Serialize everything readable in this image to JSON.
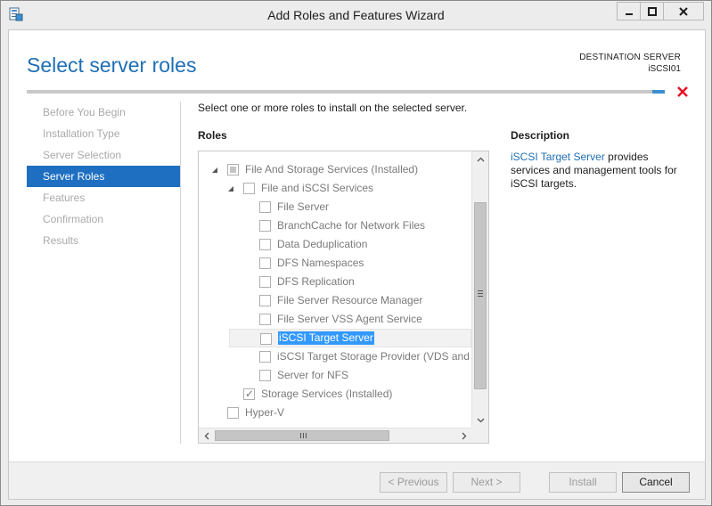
{
  "window": {
    "title": "Add Roles and Features Wizard",
    "minimize_label": "Minimize",
    "maximize_label": "Maximize",
    "close_label": "Close"
  },
  "header": {
    "page_title": "Select server roles",
    "destination_label": "DESTINATION SERVER",
    "destination_server": "iSCSI01"
  },
  "nav": {
    "items": [
      {
        "label": "Before You Begin",
        "active": false
      },
      {
        "label": "Installation Type",
        "active": false
      },
      {
        "label": "Server Selection",
        "active": false
      },
      {
        "label": "Server Roles",
        "active": true
      },
      {
        "label": "Features",
        "active": false
      },
      {
        "label": "Confirmation",
        "active": false
      },
      {
        "label": "Results",
        "active": false
      }
    ]
  },
  "main": {
    "instruction": "Select one or more roles to install on the selected server.",
    "roles_header": "Roles",
    "description_header": "Description",
    "description_link": "iSCSI Target Server",
    "description_text": " provides services and management tools for iSCSI targets."
  },
  "roles": [
    {
      "label": "File And Storage Services (Installed)",
      "level": 0,
      "expander": "expanded",
      "state": "partial"
    },
    {
      "label": "File and iSCSI Services",
      "level": 1,
      "expander": "expanded",
      "state": "unchecked"
    },
    {
      "label": "File Server",
      "level": 2,
      "expander": "",
      "state": "unchecked"
    },
    {
      "label": "BranchCache for Network Files",
      "level": 2,
      "expander": "",
      "state": "unchecked"
    },
    {
      "label": "Data Deduplication",
      "level": 2,
      "expander": "",
      "state": "unchecked"
    },
    {
      "label": "DFS Namespaces",
      "level": 2,
      "expander": "",
      "state": "unchecked"
    },
    {
      "label": "DFS Replication",
      "level": 2,
      "expander": "",
      "state": "unchecked"
    },
    {
      "label": "File Server Resource Manager",
      "level": 2,
      "expander": "",
      "state": "unchecked"
    },
    {
      "label": "File Server VSS Agent Service",
      "level": 2,
      "expander": "",
      "state": "unchecked"
    },
    {
      "label": "iSCSI Target Server",
      "level": 2,
      "expander": "",
      "state": "unchecked",
      "selected": true
    },
    {
      "label": "iSCSI Target Storage Provider (VDS and VSS",
      "level": 2,
      "expander": "",
      "state": "unchecked"
    },
    {
      "label": "Server for NFS",
      "level": 2,
      "expander": "",
      "state": "unchecked"
    },
    {
      "label": "Storage Services (Installed)",
      "level": 1,
      "expander": "",
      "state": "checked"
    },
    {
      "label": "Hyper-V",
      "level": 0,
      "expander": "",
      "state": "unchecked"
    }
  ],
  "footer": {
    "previous_label": "< Previous",
    "next_label": "Next >",
    "install_label": "Install",
    "cancel_label": "Cancel"
  },
  "colors": {
    "accent": "#1f6fb5",
    "nav_active": "#1e6fc1",
    "selection": "#3399ff",
    "error": "#e81123"
  }
}
